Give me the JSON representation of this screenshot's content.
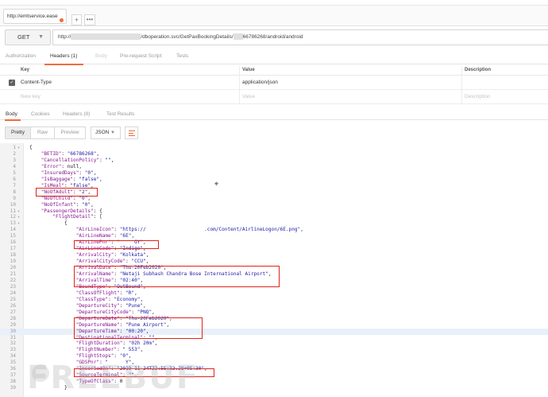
{
  "tab": {
    "title": "http://emtservice.ease",
    "new_label": "+",
    "more_label": "•••"
  },
  "request": {
    "method": "GET",
    "url_prefix": "http://",
    "url_path": "/dboperation.svc/GetPaxBookingDetails/",
    "url_id": "66786268",
    "url_suffix": "/android/android"
  },
  "request_tabs": [
    {
      "label": "Authorization",
      "active": false
    },
    {
      "label": "Headers (1)",
      "active": true
    },
    {
      "label": "Body",
      "active": false
    },
    {
      "label": "Pre-request Script",
      "active": false
    },
    {
      "label": "Tests",
      "active": false
    }
  ],
  "headers_table": {
    "columns": [
      "Key",
      "Value",
      "Description"
    ],
    "rows": [
      {
        "key": "Content-Type",
        "value": "application/json",
        "description": "",
        "checked": true
      }
    ],
    "placeholder": {
      "key": "New key",
      "value": "Value",
      "description": "Description"
    }
  },
  "response_tabs": [
    {
      "label": "Body",
      "active": true
    },
    {
      "label": "Cookies",
      "active": false
    },
    {
      "label": "Headers (8)",
      "active": false
    },
    {
      "label": "Test Results",
      "active": false
    }
  ],
  "view_modes": [
    {
      "label": "Pretty",
      "active": true
    },
    {
      "label": "Raw",
      "active": false
    },
    {
      "label": "Preview",
      "active": false
    }
  ],
  "format": "JSON",
  "code_lines": [
    {
      "n": "1",
      "fold": "▾",
      "text": "{"
    },
    {
      "n": "2",
      "fold": "",
      "text": "    \"BETID\": \"66786268\","
    },
    {
      "n": "3",
      "fold": "",
      "text": "    \"CancellationPolicy\": \"\","
    },
    {
      "n": "4",
      "fold": "",
      "text": "    \"Error\": null,"
    },
    {
      "n": "5",
      "fold": "",
      "text": "    \"InsuredDays\": \"0\","
    },
    {
      "n": "6",
      "fold": "",
      "text": "    \"IsBaggage\": \"false\","
    },
    {
      "n": "7",
      "fold": "",
      "text": "    \"IsMeal\": \"false\","
    },
    {
      "n": "8",
      "fold": "",
      "text": "    \"NoOfAdult\": \"2\","
    },
    {
      "n": "9",
      "fold": "",
      "text": "    \"NoOfChild\": \"0\","
    },
    {
      "n": "10",
      "fold": "",
      "text": "    \"NoOfInfant\": \"0\","
    },
    {
      "n": "11",
      "fold": "▾",
      "text": "    \"PassengerDetails\": {"
    },
    {
      "n": "12",
      "fold": "▾",
      "text": "        \"FlightDetail\": ["
    },
    {
      "n": "13",
      "fold": "▾",
      "text": "            {"
    },
    {
      "n": "14",
      "fold": "",
      "text": "                \"AirLineIcon\": \"https://                    .com/Content/AirlineLogon/6E.png\","
    },
    {
      "n": "15",
      "fold": "",
      "text": "                \"AirLineName\": \"6E\","
    },
    {
      "n": "16",
      "fold": "",
      "text": "                \"AirLinePnr\": \"     GY\","
    },
    {
      "n": "17",
      "fold": "",
      "text": "                \"AirLineCode\": \"Indigo\","
    },
    {
      "n": "18",
      "fold": "",
      "text": "                \"ArrivalCity\": \"Kolkata\","
    },
    {
      "n": "19",
      "fold": "",
      "text": "                \"ArrivalCityCode\": \"CCU\","
    },
    {
      "n": "20",
      "fold": "",
      "text": "                \"ArrivalDate\": \"Thu-20Feb2020\","
    },
    {
      "n": "21",
      "fold": "",
      "text": "                \"ArrivalName\": \"Netaji Subhash Chandra Bose International Airport\","
    },
    {
      "n": "22",
      "fold": "",
      "text": "                \"ArrivalTime\": \"02:40\","
    },
    {
      "n": "23",
      "fold": "",
      "text": "                \"BoundType\": \"OutBound\","
    },
    {
      "n": "24",
      "fold": "",
      "text": "                \"ClassOfFlight\": \"R\","
    },
    {
      "n": "25",
      "fold": "",
      "text": "                \"ClassType\": \"Economy\","
    },
    {
      "n": "26",
      "fold": "",
      "text": "                \"DepartureCity\": \"Pune\","
    },
    {
      "n": "27",
      "fold": "",
      "text": "                \"DepartureCityCode\": \"PNQ\","
    },
    {
      "n": "28",
      "fold": "",
      "text": "                \"DepartureDate\": \"Thu-20Feb2020\","
    },
    {
      "n": "29",
      "fold": "",
      "text": "                \"DepartureName\": \"Pune Airport\","
    },
    {
      "n": "30",
      "fold": "",
      "text": "                \"DepartureTime\": \"00:20\","
    },
    {
      "n": "31",
      "fold": "",
      "text": "                \"DestinationalTerminal\": \"\","
    },
    {
      "n": "32",
      "fold": "",
      "text": "                \"FlightDuration\": \"02h 20m\","
    },
    {
      "n": "33",
      "fold": "",
      "text": "                \"FlightNumber\": \" 553\","
    },
    {
      "n": "34",
      "fold": "",
      "text": "                \"FlightStops\": \"0\","
    },
    {
      "n": "35",
      "fold": "",
      "text": "                \"GDSPnr\": \"      Y\","
    },
    {
      "n": "36",
      "fold": "",
      "text": "                \"InsertedOn\": \"2019-11-24T22:55:32.28+05:30\","
    },
    {
      "n": "37",
      "fold": "",
      "text": "                \"SourceTerminal\": \"\","
    },
    {
      "n": "38",
      "fold": "",
      "text": "                \"TypeOfClass\": 0"
    },
    {
      "n": "39",
      "fold": "",
      "text": "            }"
    }
  ],
  "highlighted_line": "30",
  "watermark": "FREEBUF",
  "colors": {
    "accent": "#f26b3a",
    "annotation": "#e0241b",
    "string": "#1a1aa6",
    "key": "#881391"
  }
}
